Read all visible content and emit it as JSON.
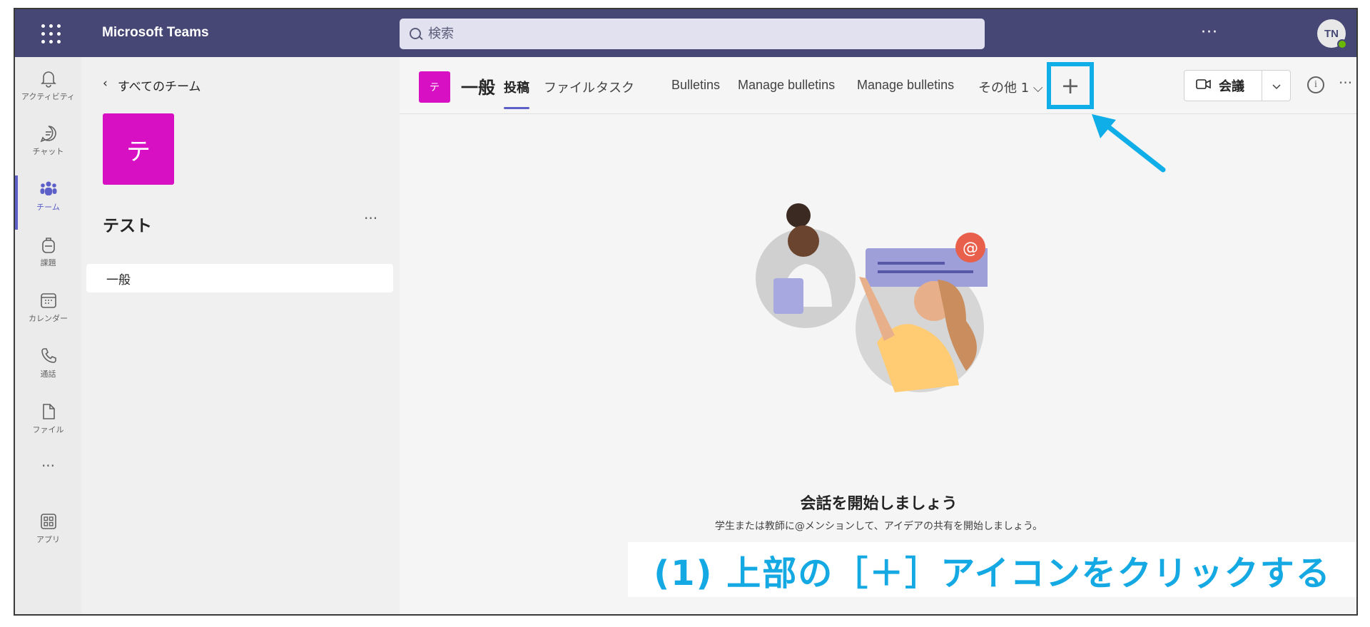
{
  "app": {
    "name": "Microsoft Teams"
  },
  "search": {
    "placeholder": "検索"
  },
  "top_more": "···",
  "user": {
    "initials": "TN",
    "presence": "available"
  },
  "rail": [
    {
      "label": "アクティビティ",
      "icon": "bell-icon"
    },
    {
      "label": "チャット",
      "icon": "chat-icon"
    },
    {
      "label": "チーム",
      "icon": "teams-icon",
      "active": true
    },
    {
      "label": "課題",
      "icon": "backpack-icon"
    },
    {
      "label": "カレンダー",
      "icon": "calendar-icon"
    },
    {
      "label": "通話",
      "icon": "phone-icon"
    },
    {
      "label": "ファイル",
      "icon": "file-icon"
    },
    {
      "label": "···",
      "icon": "more-icon"
    },
    {
      "label": "アプリ",
      "icon": "apps-icon"
    }
  ],
  "team_panel": {
    "back_label": "すべてのチーム",
    "avatar_letter": "テ",
    "team_name": "テスト",
    "more": "···",
    "channels": [
      {
        "name": "一般",
        "selected": true
      }
    ]
  },
  "channel": {
    "avatar_letter": "テ",
    "name": "一般",
    "tabs": [
      {
        "label": "投稿",
        "active": true
      },
      {
        "label": "ファイル"
      },
      {
        "label": "タスク"
      },
      {
        "label": "Bulletins"
      },
      {
        "label": "Manage bulletins"
      },
      {
        "label": "Manage bulletins"
      },
      {
        "label": "その他 1 ⌵"
      }
    ],
    "add_tab": "+",
    "meet_label": "会議",
    "info": "i",
    "more": "···"
  },
  "empty_state": {
    "title": "会話を開始しましょう",
    "subtitle": "学生または教師に@メンションして、アイデアの共有を開始しましょう。"
  },
  "annotation": {
    "instruction": "(1) 上部の［＋］アイコンをクリックする",
    "highlight_color": "#10aee8"
  },
  "colors": {
    "topbar": "#464775",
    "accent": "#5b5fc7",
    "team_avatar": "#d810c4",
    "annotation": "#15a9e4"
  }
}
